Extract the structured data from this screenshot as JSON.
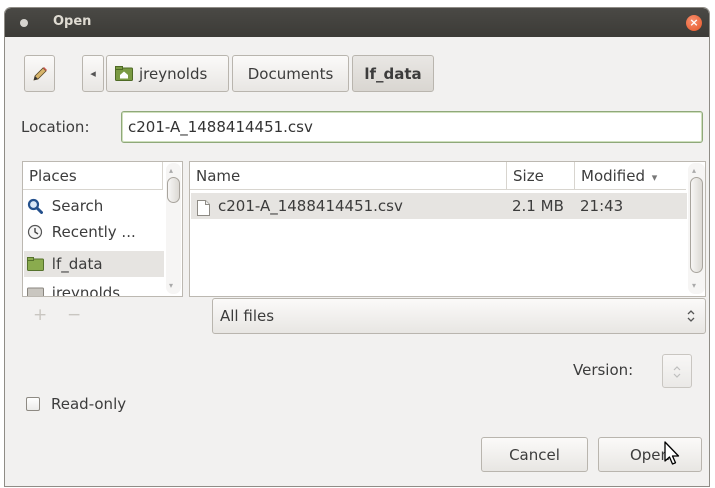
{
  "window": {
    "title": "Open",
    "close_glyph": "×"
  },
  "toolbar": {
    "edit_icon": "pencil-icon",
    "back_glyph": "◂",
    "breadcrumbs": [
      {
        "label": "jreynolds",
        "icon": "home-folder-icon"
      },
      {
        "label": "Documents"
      },
      {
        "label": "lf_data",
        "active": true
      }
    ]
  },
  "location": {
    "label": "Location:",
    "value": "c201-A_1488414451.csv"
  },
  "places": {
    "header": "Places",
    "items": [
      {
        "label": "Search",
        "icon": "search-icon"
      },
      {
        "label": "Recently ...",
        "icon": "recent-clock-icon"
      },
      {
        "label": "lf_data",
        "icon": "folder-icon",
        "selected": true
      },
      {
        "label": "jreynolds",
        "icon": "folder-icon"
      }
    ],
    "add_glyph": "+",
    "remove_glyph": "−"
  },
  "files": {
    "columns": {
      "name": "Name",
      "size": "Size",
      "modified": "Modified",
      "sort_glyph": "▾"
    },
    "rows": [
      {
        "name": "c201-A_1488414451.csv",
        "size": "2.1 MB",
        "modified": "21:43",
        "icon": "document-icon"
      }
    ]
  },
  "filter": {
    "value": "All files",
    "arrow_glyph": "⌃⌄"
  },
  "version": {
    "label": "Version:"
  },
  "readonly": {
    "label": "Read-only",
    "checked": false
  },
  "buttons": {
    "cancel": "Cancel",
    "open": "Open"
  },
  "colors": {
    "titlebar": "#3c3b37",
    "close": "#e55525",
    "selection": "#e6e4e1",
    "focus_border": "#8fa87a"
  }
}
